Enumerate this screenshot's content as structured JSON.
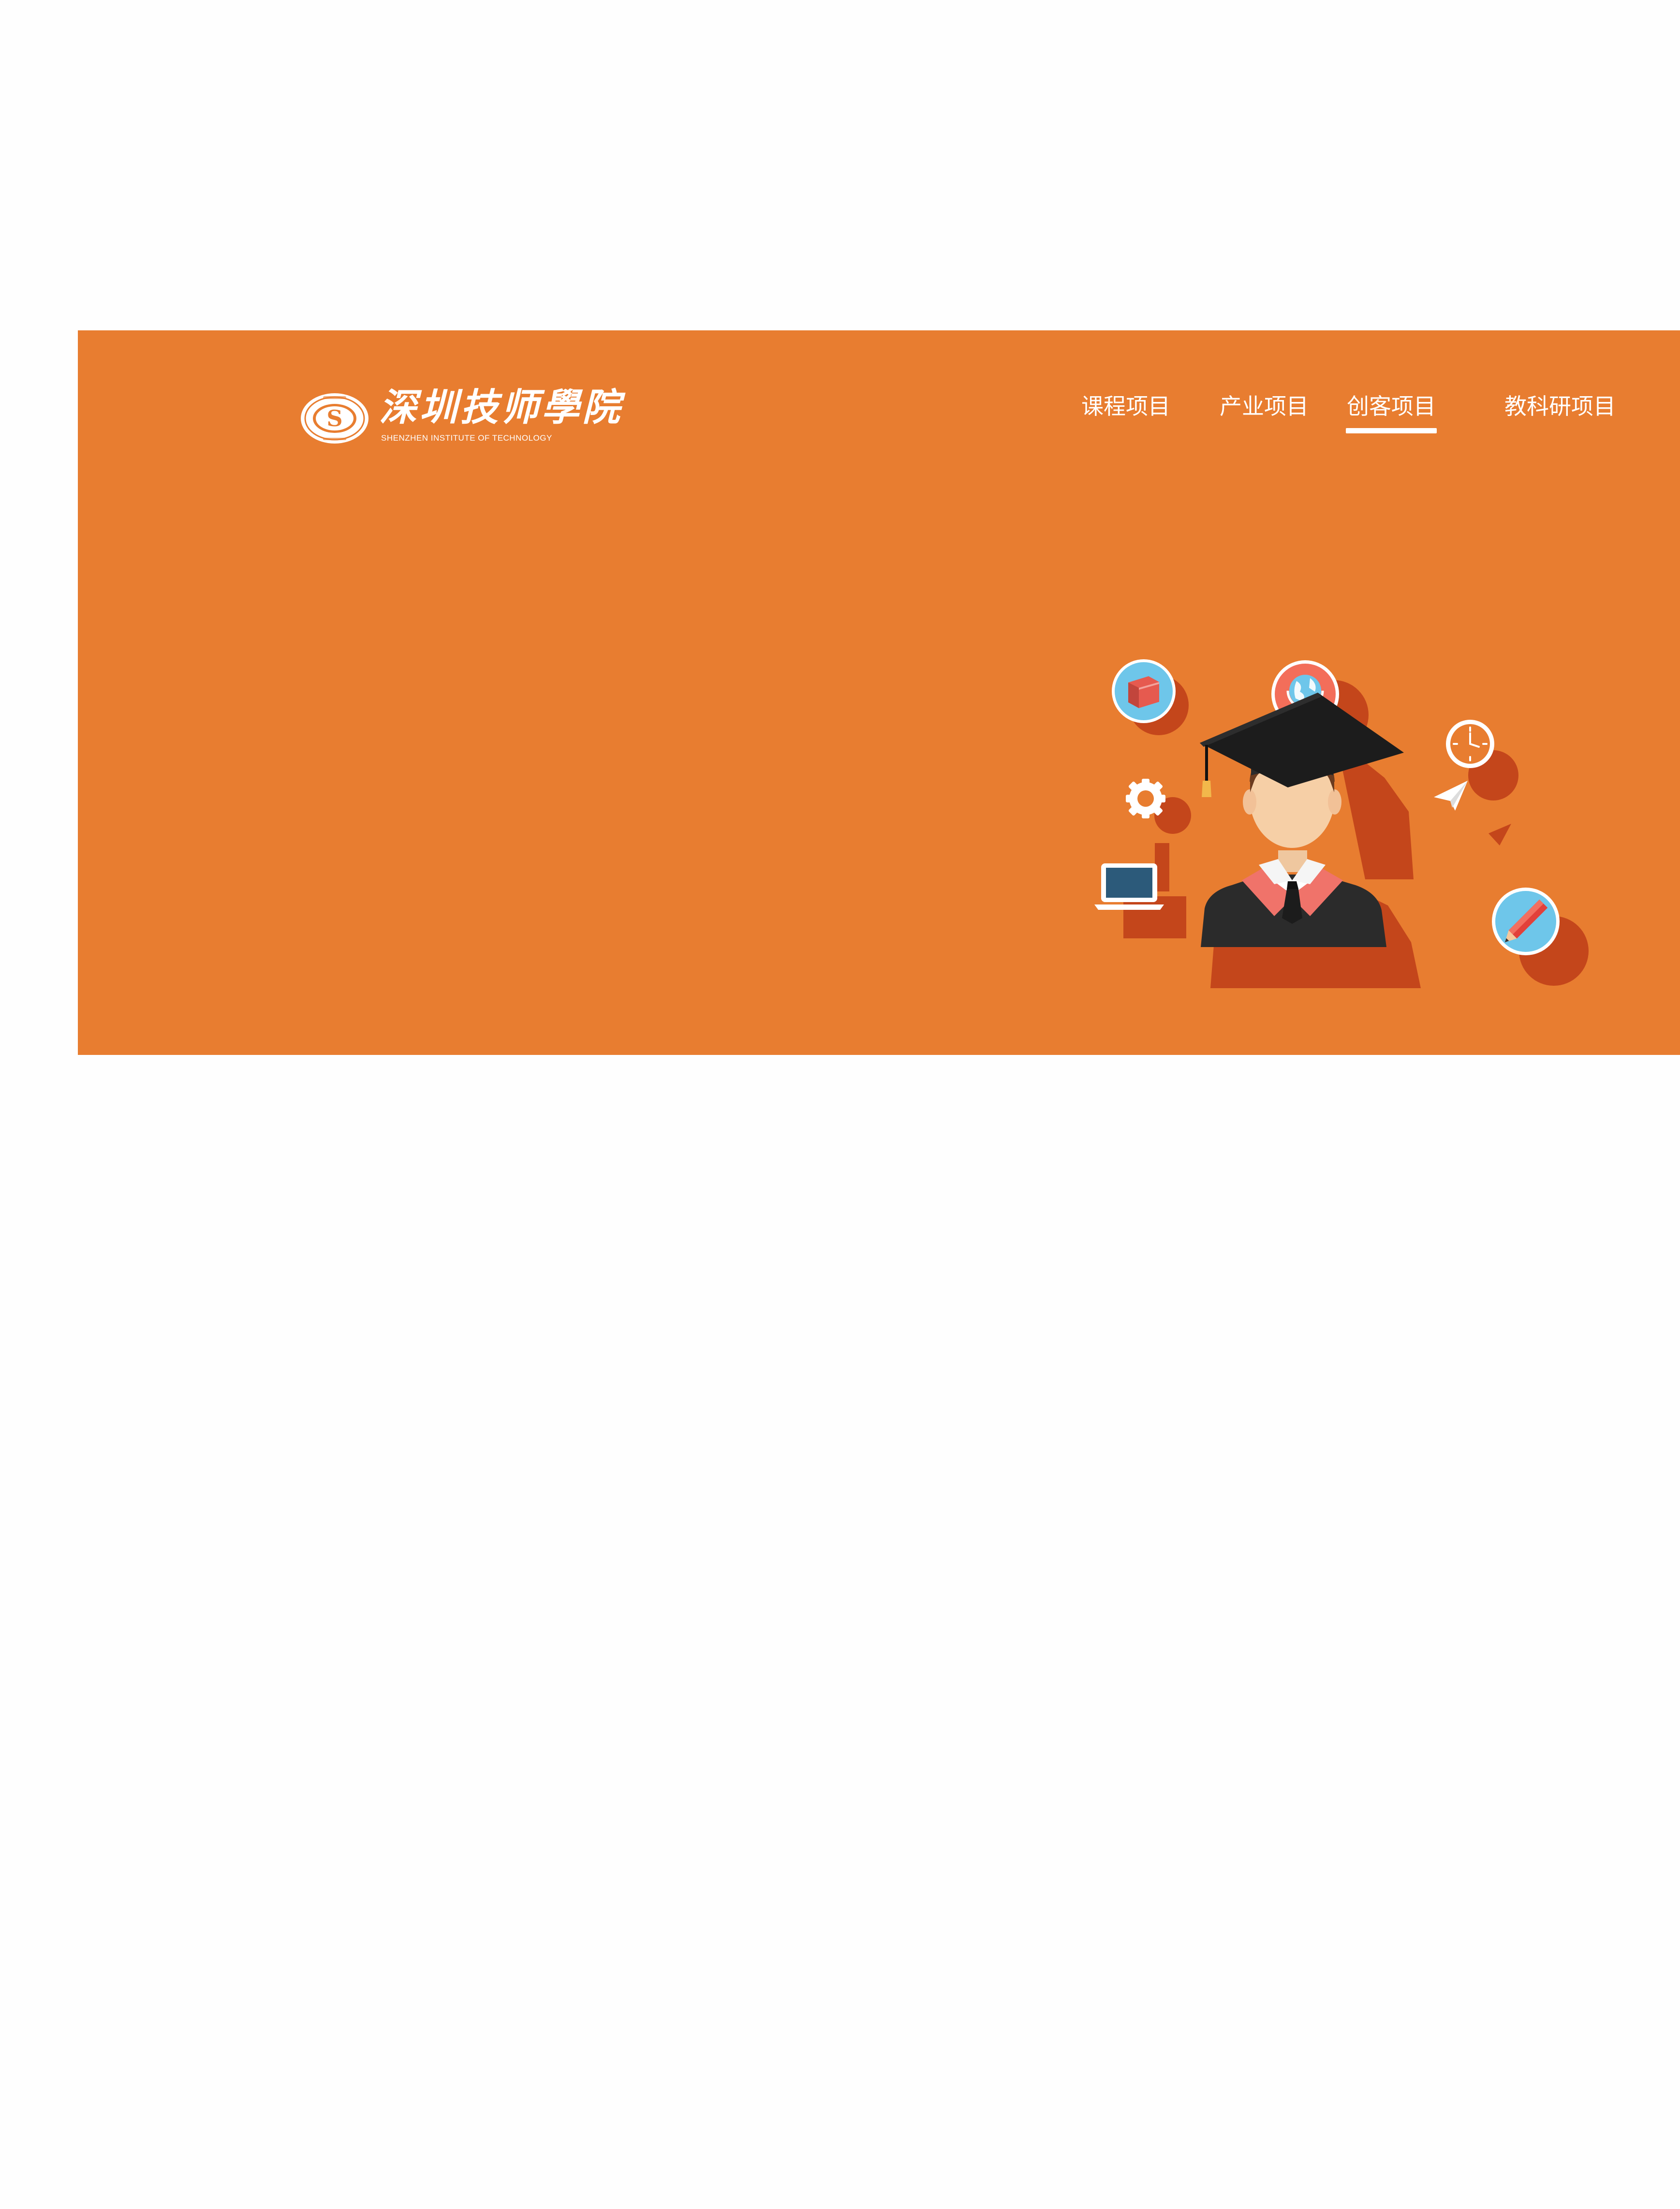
{
  "header": {
    "logo": {
      "title": "深圳技师學院",
      "subtitle": "SHENZHEN INSTITUTE OF TECHNOLOGY",
      "seal_letter": "S"
    },
    "nav": [
      {
        "label": "课程项目",
        "active": false
      },
      {
        "label": "产业项目",
        "active": false
      },
      {
        "label": "创客项目",
        "active": true
      },
      {
        "label": "教科研项目",
        "active": false
      }
    ]
  },
  "theme": {
    "banner_color": "#e87d30",
    "shadow_color": "#c4461b",
    "text_color": "#ffffff"
  },
  "illustration": {
    "subject": "graduate-student-icon",
    "icons": [
      "book-icon",
      "globe-icon",
      "clock-icon",
      "gear-icon",
      "laptop-icon",
      "paper-plane-icon",
      "pencil-icon"
    ]
  }
}
